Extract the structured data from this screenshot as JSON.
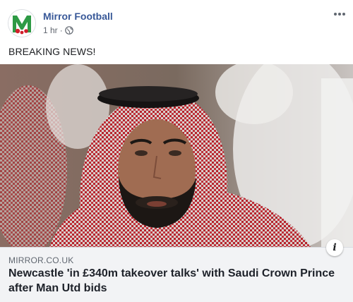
{
  "post": {
    "page_name": "Mirror Football",
    "time": "1 hr",
    "separator": "·",
    "audience_icon": "globe-icon",
    "text": "BREAKING NEWS!",
    "more_icon": "more-horizontal-icon",
    "avatar_icon": "mirror-football-logo"
  },
  "link_preview": {
    "domain": "MIRROR.CO.UK",
    "headline": "Newcastle 'in £340m takeover talks' with Saudi Crown Prince after Man Utd bids",
    "info_icon": "info-icon",
    "info_glyph": "i"
  },
  "colors": {
    "page_name": "#385898",
    "link_box_bg": "#f2f3f5",
    "logo_green": "#2e9a45",
    "logo_red": "#d21f2b"
  }
}
